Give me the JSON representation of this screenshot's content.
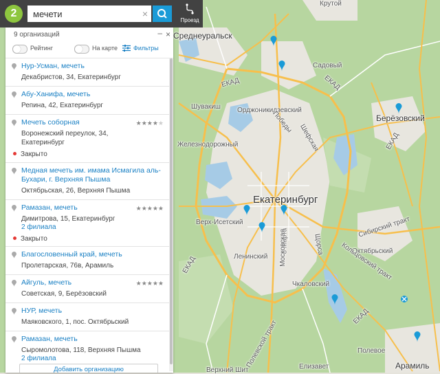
{
  "search": {
    "value": "мечети",
    "clear_icon": "close-icon",
    "search_icon": "magnifier-icon"
  },
  "route": {
    "label": "Проезд",
    "icon": "route-icon"
  },
  "logo": {
    "icon": "2gis-logo"
  },
  "panel": {
    "count": "9 организаций",
    "minimize": "–",
    "close": "×",
    "filters": {
      "rating_label": "Рейтинг",
      "on_map_label": "На карте",
      "filters_link": "Фильтры"
    },
    "items": [
      {
        "name": "Нур-Усман, мечеть",
        "address": "Декабристов, 34, Екатеринбург"
      },
      {
        "name": "Абу-Ханифа, мечеть",
        "address": "Репина, 42, Екатеринбург"
      },
      {
        "name": "Мечеть соборная",
        "address": "Воронежский переулок, 34, Екатеринбург",
        "status": "Закрыто",
        "rating": 4
      },
      {
        "name": "Медная мечеть им. имама Исмагила аль-Бухари, г. Верхняя Пышма",
        "address": "Октябрьская, 26, Верхняя Пышма"
      },
      {
        "name": "Рамазан, мечеть",
        "address": "Димитрова, 15, Екатеринбург",
        "branches": "2 филиала",
        "status": "Закрыто",
        "rating": 5
      },
      {
        "name": "Благословенный край, мечеть",
        "address": "Пролетарская, 76в, Арамиль"
      },
      {
        "name": "Айгуль, мечеть",
        "address": "Советская, 9, Берёзовский",
        "rating": 5
      },
      {
        "name": "НУР, мечеть",
        "address": "Маяковского, 1, пос. Октябрьский"
      },
      {
        "name": "Рамазан, мечеть",
        "address": "Сыромолотова, 118, Верхняя Пышма",
        "branches": "2 филиала"
      }
    ],
    "add_org": "Добавить организацию"
  },
  "map": {
    "labels": {
      "krutoy": "Крутой",
      "sredneuralsk": "Среднеуральск",
      "sadoviy": "Садовый",
      "ekad1": "ЕКАД",
      "ekad2": "ЕКАД",
      "ekad3": "ЕКАД",
      "ekad4": "ЕКАД",
      "ekad5": "ЕКАД",
      "shuvakish": "Шувакиш",
      "ordzhon": "Орджоникидзевский",
      "berezovsky": "Берёзовский",
      "pobedy": "Победы",
      "shefskaya": "Шефская",
      "zheleznodor": "Железнодорожный",
      "ekb": "Екатеринбург",
      "verh_isetsky": "Верх-Исетский",
      "leninsky": "Ленинский",
      "oktyabrsky": "Октябрьский",
      "chkalovsky": "Чкаловский",
      "polevskoy": "Полевской тракт",
      "kolcovsky": "Кольцовский тракт",
      "sibirsky": "Сибирский тракт",
      "marta": "8 Марта",
      "moskovskaya": "Московская",
      "shchorsa": "Щорса",
      "elizavet": "Елизавет",
      "polevoe": "Полевое",
      "aramil": "Арамиль",
      "verhnyaya_shit": "Верхний Шит"
    }
  },
  "colors": {
    "topbar": "#424242",
    "accent": "#1a9bd7",
    "link": "#1a80c4",
    "logo": "#8ec63f",
    "closed": "#e53935",
    "forest": "#b7d6a0",
    "water": "#a6cbe6",
    "road": "#f7bf4c"
  }
}
